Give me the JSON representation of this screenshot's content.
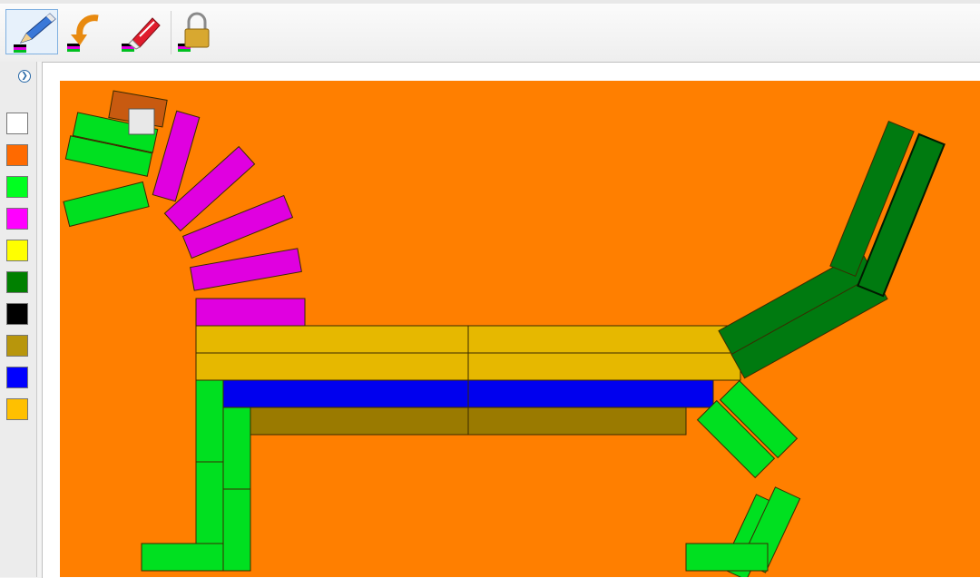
{
  "toolbar": {
    "tools": [
      {
        "name": "pencil-tool",
        "icon": "pencil-icon",
        "active": true
      },
      {
        "name": "undo-tool",
        "icon": "undo-arrow-icon",
        "active": false
      },
      {
        "name": "eraser-tool",
        "icon": "eraser-icon",
        "active": false
      },
      {
        "name": "lock-tool",
        "icon": "padlock-icon",
        "active": false
      }
    ]
  },
  "sidebar": {
    "expand_icon": "chevron-right-icon",
    "palette": [
      "#ffffff",
      "#ff6a00",
      "#00ff20",
      "#ff00ff",
      "#ffff00",
      "#008000",
      "#000000",
      "#b8960c",
      "#0000ff",
      "#ffc000"
    ]
  },
  "canvas": {
    "background": "#ff7f00",
    "block_colors": {
      "green": "#00e020",
      "dark_green": "#007a10",
      "magenta": "#e000e0",
      "gold": "#e6b800",
      "olive": "#9a7a00",
      "blue": "#0000ee",
      "brown": "#c85a10",
      "white": "#e8e8e8"
    }
  }
}
